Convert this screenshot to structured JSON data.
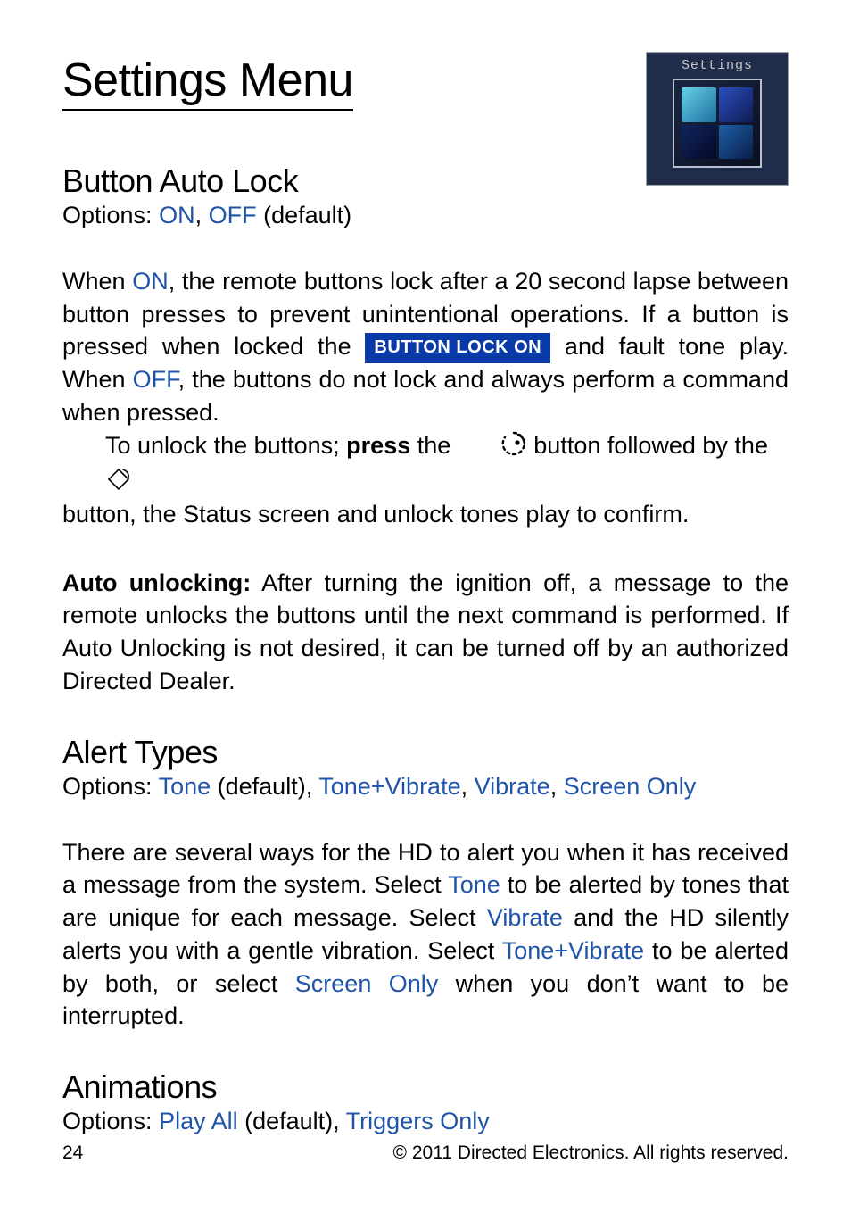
{
  "title": "Settings Menu",
  "thumb_label": "Settings",
  "sections": {
    "button_auto_lock": {
      "heading": "Button Auto Lock",
      "options_label": "Options: ",
      "opt_on": "ON",
      "opt_off": "OFF",
      "default_suffix": " (default)",
      "p1_a": "When ",
      "p1_on": "ON",
      "p1_b": ", the remote buttons lock after a 20 second lapse between button presses to prevent unintentional operations. If a button is pressed when locked the ",
      "badge": "BUTTON LOCK ON",
      "p1_c": " and fault tone play. When ",
      "p1_off": "OFF",
      "p1_d": ", the buttons do not lock and always perform a command when pressed.",
      "p2_a": "To unlock the buttons; ",
      "p2_press": "press",
      "p2_b": " the ",
      "p2_c": " button followed by the ",
      "p2_d": " button, the Status screen and unlock tones play to confirm.",
      "auto_label": "Auto unlocking:",
      "auto_text": " After turning the ignition off, a message to the remote unlocks the buttons until the next command is performed. If Auto Unlocking is not desired, it can be turned off by an authorized Directed Dealer."
    },
    "alert_types": {
      "heading": "Alert Types",
      "options_label": "Options: ",
      "opt_tone": "Tone",
      "default_suffix": " (default), ",
      "opt_tv": "Tone+Vibrate",
      "sep": ", ",
      "opt_vib": "Vibrate",
      "opt_screen": "Screen Only",
      "p_a": "There are several ways for the HD to alert you when it has received a message from the system. Select ",
      "p_tone": "Tone",
      "p_b": " to be alerted by tones that are unique for each message. Select ",
      "p_vib": "Vibrate",
      "p_c": " and the HD silently alerts you with a gentle vibration. Select ",
      "p_tv": "Tone+Vibrate",
      "p_d": " to be alerted by both, or select ",
      "p_screen": "Screen Only",
      "p_e": " when you don’t want to be interrupted."
    },
    "animations": {
      "heading": "Animations",
      "options_label": "Options: ",
      "opt_play": "Play All",
      "default_suffix": " (default), ",
      "opt_trig": "Triggers Only"
    }
  },
  "footer": {
    "page": "24",
    "copyright": "© 2011 Directed Electronics. All rights reserved."
  }
}
